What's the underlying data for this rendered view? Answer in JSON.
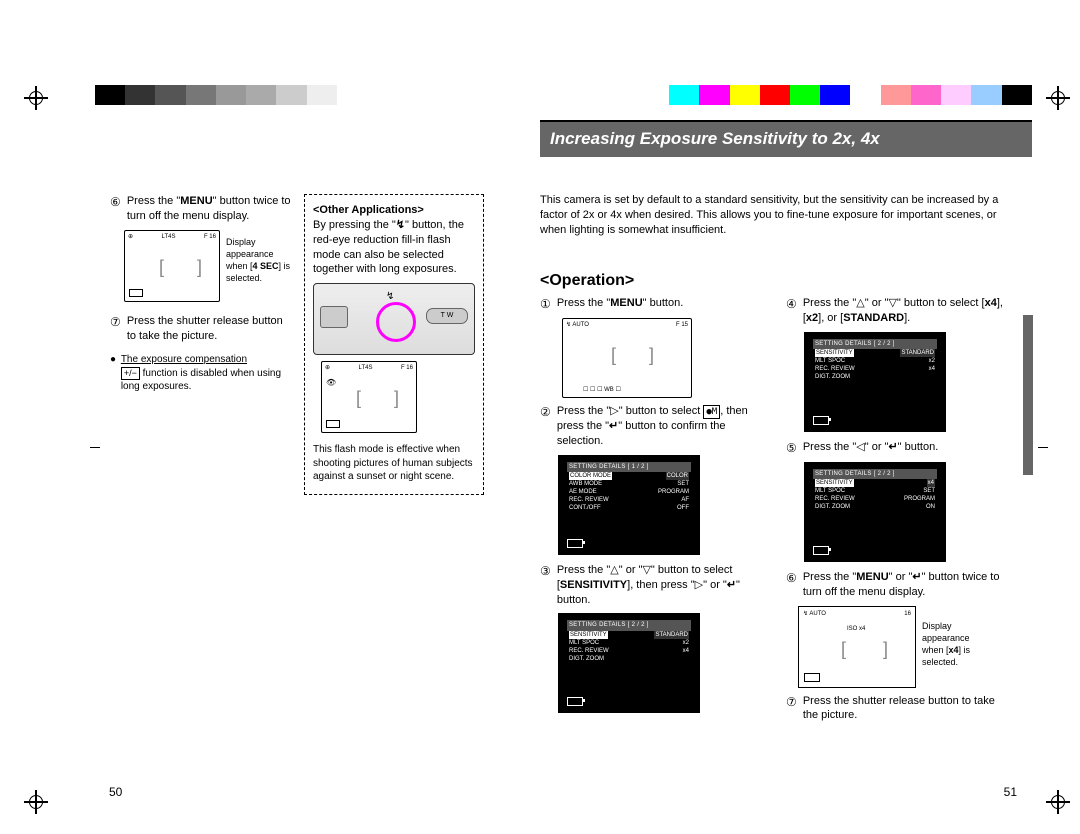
{
  "color_strip": [
    "#000",
    "#333",
    "#555",
    "#777",
    "#999",
    "#aaa",
    "#ccc",
    "#eee",
    "#fff",
    "#fff",
    "#fff",
    "#fff",
    "#fff",
    "#fff",
    "#fff",
    "#fff",
    "#fff",
    "#fff",
    "#fff",
    "#0ff",
    "#f0f",
    "#ff0",
    "#f00",
    "#0f0",
    "#00f",
    "#fff",
    "#f99",
    "#f6c",
    "#fcf",
    "#9cf",
    "#000"
  ],
  "section_title": "Increasing Exposure Sensitivity to 2x, 4x",
  "page_left": "50",
  "page_right": "51",
  "left": {
    "step6_num": "⑥",
    "step6_pre": "Press the \"",
    "step6_menu": "MENU",
    "step6_post": "\" button twice to turn off the menu display.",
    "lcd1_mode": "LT4S",
    "lcd1_f": "F   16",
    "lcd1_flash": "⊕",
    "display_caption_pre": "Display appearance when [",
    "display_caption_bold": "4 SEC",
    "display_caption_post": "] is selected.",
    "step7_num": "⑦",
    "step7": "Press the shutter release button to take the picture.",
    "note_bullet": "●",
    "note_pre": "The exposure compensation ",
    "note_icon": "+/−",
    "note_post": " function is disabled when using long exposures.",
    "note_underline": "The exposure compensation"
  },
  "other_app": {
    "title": "<Other Applications>",
    "para_pre": "By pressing the \"",
    "para_icon": "↯",
    "para_post": "\" button, the red-eye reduction fill-in flash mode can also be selected together with long exposures.",
    "camera_zoom": "T     W",
    "lcd_mode": "LT4S",
    "lcd_f": "F   16",
    "lcd_flash": "⊕",
    "lcd_eye": "👁",
    "caption": "This flash mode is effective when shooting pictures of human subjects against a sunset or night scene."
  },
  "intro": "This camera is set by default to a standard sensitivity, but the sensitivity can be increased by a factor of 2x or 4x when desired. This allows you to fine-tune exposure for important scenes, or when lighting is somewhat insufficient.",
  "operation_heading": "<Operation>",
  "op": {
    "s1_num": "①",
    "s1_pre": "Press the \"",
    "s1_menu": "MENU",
    "s1_post": "\" button.",
    "lcd1_flash": "↯ AUTO",
    "lcd1_f": "F   15",
    "lcd1_icons": "☐  ☐  ☐  WB  ☐",
    "s2_num": "②",
    "s2_pre": "Press the \"",
    "s2_tri": "▷",
    "s2_mid1": "\" button to select ",
    "s2_box": "●M",
    "s2_mid2": ", then press the \"",
    "s2_enter": "↵",
    "s2_post": "\" button to confirm the selection.",
    "menu1_title": "SETTING DETAILS [ 1 / 2 ]",
    "menu1_rows": [
      {
        "k": "COLOR MODE",
        "v": "COLOR",
        "sel": true
      },
      {
        "k": "AWB MODE",
        "v": "SET"
      },
      {
        "k": "AE MODE",
        "v": "PROGRAM"
      },
      {
        "k": "REC. REVIEW",
        "v": "AF"
      },
      {
        "k": "CONT./OFF",
        "v": "OFF"
      }
    ],
    "s3_num": "③",
    "s3_pre": "Press the \"",
    "s3_up": "△",
    "s3_or1": "\" or \"",
    "s3_down": "▽",
    "s3_mid1": "\" button to select [",
    "s3_sens": "SENSITIVITY",
    "s3_mid2": "], then press \"",
    "s3_right": "▷",
    "s3_or2": "\" or \"",
    "s3_enter": "↵",
    "s3_post": "\" button.",
    "menu2_title": "SETTING DETAILS [ 2 / 2 ]",
    "menu2_rows": [
      {
        "k": "SENSITIVITY",
        "v": "STANDARD",
        "sel": true
      },
      {
        "k": "MLT SPOC",
        "v": "x2"
      },
      {
        "k": "REC. REVIEW",
        "v": "x4"
      },
      {
        "k": "DIGT. ZOOM",
        "v": ""
      }
    ],
    "s4_num": "④",
    "s4_pre": "Press the \"",
    "s4_up": "△",
    "s4_or": "\" or \"",
    "s4_down": "▽",
    "s4_mid": "\" button to select [",
    "s4_x4": "x4",
    "s4_c1": "], [",
    "s4_x2": "x2",
    "s4_c2": "], or [",
    "s4_std": "STANDARD",
    "s4_post": "].",
    "menu3_title": "SETTING DETAILS [ 2 / 2 ]",
    "menu3_rows": [
      {
        "k": "SENSITIVITY",
        "v": "STANDARD",
        "sel": true
      },
      {
        "k": "MLT SPOC",
        "v": "x2"
      },
      {
        "k": "REC. REVIEW",
        "v": "x4"
      },
      {
        "k": "DIGT. ZOOM",
        "v": ""
      }
    ],
    "s5_num": "⑤",
    "s5_pre": "Press the \"",
    "s5_left": "◁",
    "s5_or": "\" or \"",
    "s5_enter": "↵",
    "s5_post": "\" button.",
    "menu4_title": "SETTING DETAILS [ 2 / 2 ]",
    "menu4_rows": [
      {
        "k": "SENSITIVITY",
        "v": "x4",
        "sel": true
      },
      {
        "k": "MLT SPOC",
        "v": "SET"
      },
      {
        "k": "REC. REVIEW",
        "v": "PROGRAM"
      },
      {
        "k": "DIGT. ZOOM",
        "v": "ON"
      }
    ],
    "s6_num": "⑥",
    "s6_pre": "Press the \"",
    "s6_menu": "MENU",
    "s6_or": "\" or \"",
    "s6_enter": "↵",
    "s6_post": "\" button twice to turn off the menu display.",
    "lcd_iso_flash": "↯ AUTO",
    "lcd_iso_f": "16",
    "lcd_iso_iso": "ISO x4",
    "display6_pre": "Display appearance when [",
    "display6_bold": "x4",
    "display6_post": "] is selected.",
    "s7_num": "⑦",
    "s7": "Press the shutter release button to take the picture."
  }
}
